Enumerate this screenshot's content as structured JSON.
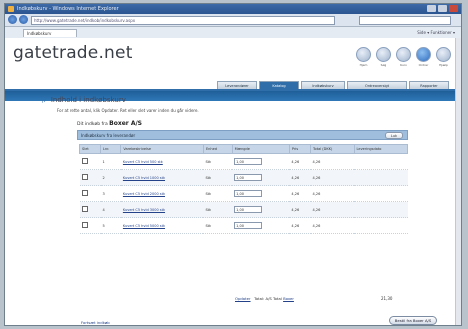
{
  "browser": {
    "window_title": "Indkøbskurv - Windows Internet Explorer",
    "url": "http://www.gatetrade.net/indkob/indkobskurv.aspx",
    "tab_label": "Indkøbskurv",
    "tools_text": "Side ▾  Funktioner ▾"
  },
  "site": {
    "logo": "gatetrade.net",
    "top_icons": [
      "Hjem",
      "Søg",
      "Kurv",
      "Ordrer",
      "Hjælp"
    ]
  },
  "nav_tabs": [
    "Leverandører",
    "Katalog",
    "Indkøbskurv",
    "Ordreoversigt",
    "Rapporter"
  ],
  "page": {
    "heading": "Indhold i indkøbskurv",
    "intro": "For at rette antal, klik Opdater. Ret eller slet varer inden du går videre.",
    "shop_label": "Dit indkøb fra",
    "shop_name": "Boxer A/S",
    "shop_bar": "Indkøbskurv fra leverandør",
    "luk_label": "Luk"
  },
  "table": {
    "headers": [
      "Slet",
      "Lnr.",
      "Varebeskrivelse",
      "Enhed",
      "Mængde",
      "Pris",
      "Total (DKK)",
      "Leveringsdato"
    ],
    "rows": [
      {
        "lnr": "1",
        "desc": "Kuvert C5 hvid 500 stk",
        "unit": "Stk",
        "qty": "1,00",
        "price": "4,26",
        "total": "4,26"
      },
      {
        "lnr": "2",
        "desc": "Kuvert C5 hvid 1000 stk",
        "unit": "Stk",
        "qty": "1,00",
        "price": "4,26",
        "total": "4,26"
      },
      {
        "lnr": "3",
        "desc": "Kuvert C5 hvid 2000 stk",
        "unit": "Stk",
        "qty": "1,00",
        "price": "4,26",
        "total": "4,26"
      },
      {
        "lnr": "4",
        "desc": "Kuvert C5 hvid 3000 stk",
        "unit": "Stk",
        "qty": "1,00",
        "price": "4,26",
        "total": "4,26"
      },
      {
        "lnr": "5",
        "desc": "Kuvert C5 hvid 5000 stk",
        "unit": "Stk",
        "qty": "1,00",
        "price": "4,26",
        "total": "4,26"
      }
    ]
  },
  "totals": {
    "update_link": "Opdater",
    "total_label": "Total: A/S Total",
    "total_link": "Boxer",
    "total_value": "21,30"
  },
  "footer": {
    "link": "Fortsæt indkøb",
    "order_button": "Bestil fra Boxer A/S"
  }
}
